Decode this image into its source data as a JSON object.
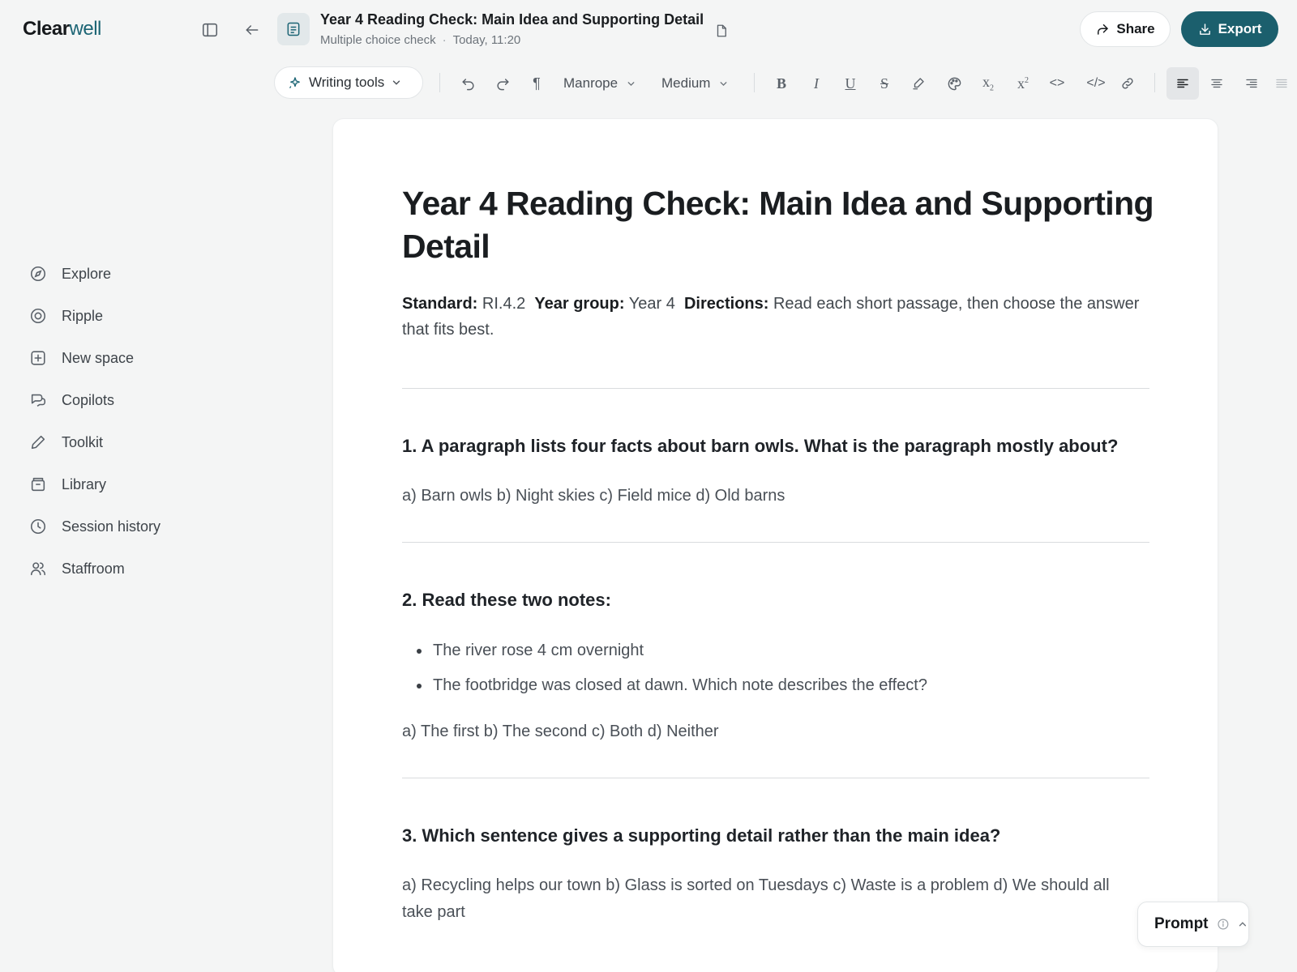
{
  "app": {
    "logo_main": "Clear",
    "logo_accent": "well"
  },
  "header": {
    "doc_title": "Year 4 Reading Check: Main Idea and Supporting Detail",
    "doc_type": "Multiple choice check",
    "doc_time": "Today, 11:20",
    "share_label": "Share",
    "export_label": "Export",
    "accent_color": "#1b5f6d"
  },
  "toolbar": {
    "writing_tools_label": "Writing tools",
    "font_family": "Manrope",
    "font_weight": "Medium",
    "paragraph_glyph": "¶",
    "bold_glyph": "B",
    "italic_glyph": "I",
    "underline_glyph": "U",
    "strike_glyph": "S",
    "code_glyph": "<>",
    "codeblock_glyph": "</>",
    "subscript_glyph": "x",
    "subscript_small": "2",
    "superscript_glyph": "x",
    "superscript_small": "2"
  },
  "sidebar": {
    "items": [
      {
        "label": "Explore",
        "icon": "compass-icon"
      },
      {
        "label": "Ripple",
        "icon": "ripple-icon"
      },
      {
        "label": "New space",
        "icon": "plus-square-icon"
      },
      {
        "label": "Copilots",
        "icon": "chat-bubbles-icon"
      },
      {
        "label": "Toolkit",
        "icon": "pencil-icon"
      },
      {
        "label": "Library",
        "icon": "archive-icon"
      },
      {
        "label": "Session history",
        "icon": "clock-icon"
      },
      {
        "label": "Staffroom",
        "icon": "users-icon"
      }
    ]
  },
  "document": {
    "title": "Year 4 Reading Check: Main Idea and Supporting Detail",
    "standard_label": "Standard:",
    "standard_value": "RI.4.2",
    "year_label": "Year group:",
    "year_value": "Year 4",
    "directions_label": "Directions:",
    "directions_value": "Read each short passage, then choose the answer that fits best.",
    "questions": [
      {
        "heading": "1. A paragraph lists four facts about barn owls. What is the paragraph mostly about?",
        "answers": "a) Barn owls b) Night skies c) Field mice d) Old barns"
      },
      {
        "heading": "2. Read these two notes:",
        "bullets": [
          "The river rose 4 cm overnight",
          "The footbridge was closed at dawn. Which note describes the effect?"
        ],
        "answers": "a) The first b) The second c) Both d) Neither"
      },
      {
        "heading": "3. Which sentence gives a supporting detail rather than the main idea?",
        "answers": "a) Recycling helps our town b) Glass is sorted on Tuesdays c) Waste is a problem d) We should all take part"
      }
    ]
  },
  "prompt": {
    "label": "Prompt"
  }
}
